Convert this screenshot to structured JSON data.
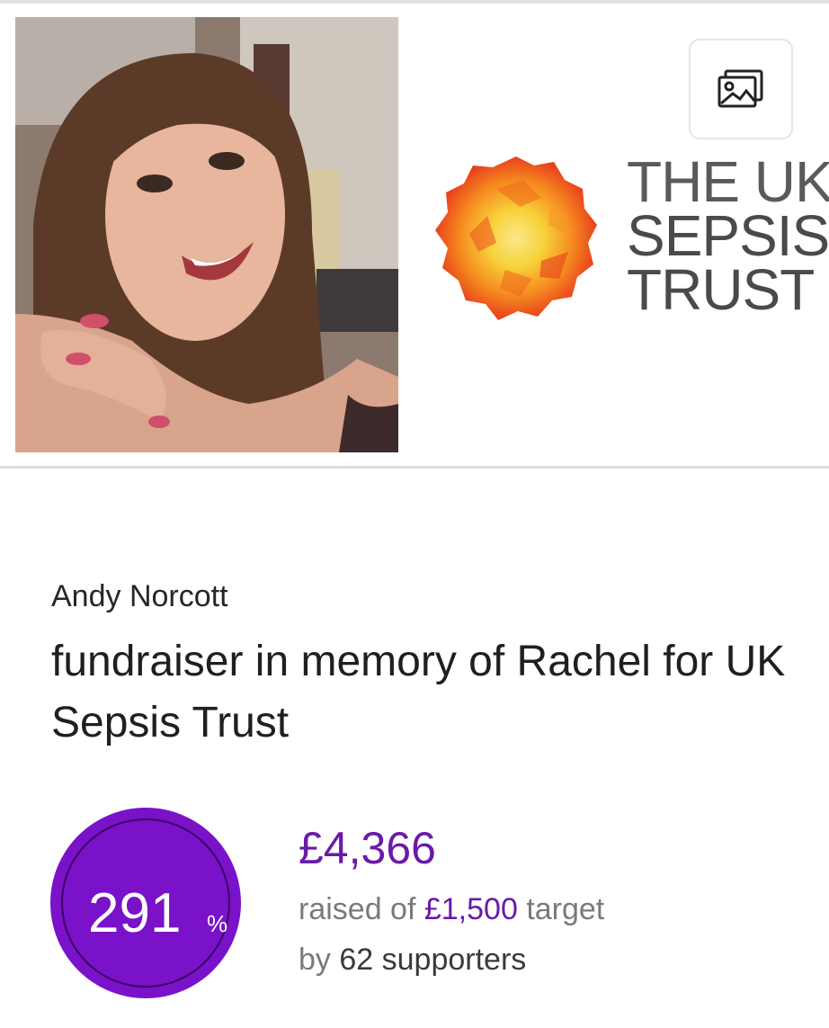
{
  "charity_logo": {
    "line1": "THE UK",
    "line2": "SEPSIS",
    "line3": "TRUST"
  },
  "gallery_icon": "image-gallery-icon",
  "fundraiser": {
    "owner": "Andy Norcott",
    "title": "fundraiser in memory of Rachel for UK Sepsis Trust"
  },
  "progress": {
    "percent": "291",
    "percent_symbol": "%",
    "raised_amount": "£4,366",
    "raised_prefix": "raised of",
    "target_amount": "£1,500",
    "target_suffix": "target",
    "supporters_prefix": "by",
    "supporters_count": "62 supporters"
  },
  "colors": {
    "accent": "#7a12c9",
    "amount_text": "#6a1aa8",
    "logo_orange": "#f26a1b",
    "logo_yellow": "#f7d23a"
  }
}
